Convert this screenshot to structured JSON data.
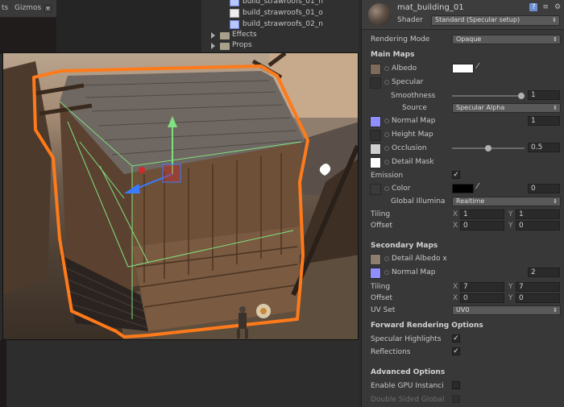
{
  "toolbar": {
    "left_cut_label": "ts",
    "gizmos_label": "Gizmos",
    "caret": "▾"
  },
  "project": {
    "files": [
      {
        "name": "build_strawroofs_01_n"
      },
      {
        "name": "build_strawroofs_01_o"
      },
      {
        "name": "build_strawroofs_02_n"
      }
    ],
    "folders": [
      {
        "name": "Effects"
      },
      {
        "name": "Props"
      }
    ]
  },
  "inspector": {
    "material_name": "mat_building_01",
    "shader_label": "Shader",
    "shader_value": "Standard (Specular setup)",
    "rendering_mode_label": "Rendering Mode",
    "rendering_mode_value": "Opaque",
    "main_maps": {
      "title": "Main Maps",
      "albedo": "Albedo",
      "specular": "Specular",
      "smoothness": "Smoothness",
      "smoothness_value": "1",
      "source": "Source",
      "source_value": "Specular Alpha",
      "normal_map": "Normal Map",
      "normal_map_value": "1",
      "height_map": "Height Map",
      "occlusion": "Occlusion",
      "occlusion_value": "0.5",
      "detail_mask": "Detail Mask",
      "emission": "Emission",
      "color": "Color",
      "color_value": "0",
      "global_illum": "Global Illumina",
      "global_illum_value": "Realtime",
      "tiling": "Tiling",
      "tiling_x": "1",
      "tiling_y": "1",
      "offset": "Offset",
      "offset_x": "0",
      "offset_y": "0"
    },
    "secondary_maps": {
      "title": "Secondary Maps",
      "detail_albedo": "Detail Albedo x",
      "normal_map": "Normal Map",
      "normal_map_value": "2",
      "tiling": "Tiling",
      "tiling_x": "7",
      "tiling_y": "7",
      "offset": "Offset",
      "offset_x": "0",
      "offset_y": "0",
      "uv_set": "UV Set",
      "uv_set_value": "UV0"
    },
    "forward": {
      "title": "Forward Rendering Options",
      "specular_highlights": "Specular Highlights",
      "reflections": "Reflections"
    },
    "advanced": {
      "title": "Advanced Options",
      "gpu_instancing": "Enable GPU Instanci",
      "double_sided": "Double Sided Global"
    },
    "x_label": "X",
    "y_label": "Y",
    "check_mark": "✓",
    "circle": "○",
    "dd_arrow": "⇕"
  },
  "colors": {
    "selection_outline": "#ff7a1a",
    "gizmo_green": "#7fe07f",
    "normal_map_swatch": "#8f8fff"
  }
}
